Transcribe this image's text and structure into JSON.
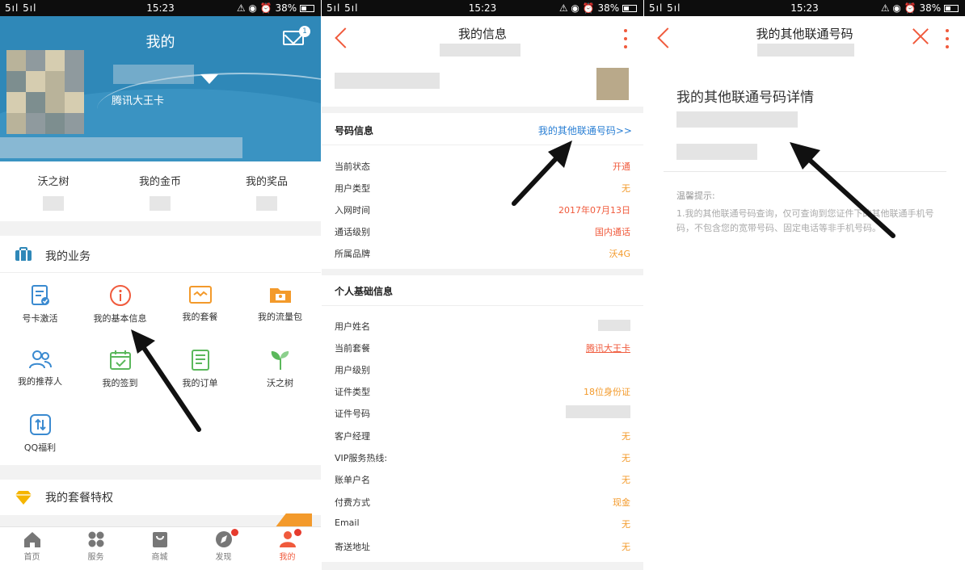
{
  "status_bar": {
    "signal": "5ıl 5ıl",
    "time": "15:23",
    "right_icons": "⚠ ◉ ⏰",
    "battery": "38%"
  },
  "panel1": {
    "title": "我的",
    "mail_badge": "1",
    "user_plan": "腾讯大王卡",
    "stats": [
      "沃之树",
      "我的金币",
      "我的奖品"
    ],
    "business_title": "我的业务",
    "services": [
      {
        "label": "号卡激活",
        "icon": "sim-activate-icon"
      },
      {
        "label": "我的基本信息",
        "icon": "info-icon"
      },
      {
        "label": "我的套餐",
        "icon": "package-icon"
      },
      {
        "label": "我的流量包",
        "icon": "data-pack-icon"
      },
      {
        "label": "我的推荐人",
        "icon": "referrer-icon"
      },
      {
        "label": "我的签到",
        "icon": "checkin-icon"
      },
      {
        "label": "我的订单",
        "icon": "order-icon"
      },
      {
        "label": "沃之树",
        "icon": "tree-icon"
      },
      {
        "label": "QQ福利",
        "icon": "qq-benefit-icon"
      }
    ],
    "privilege_title": "我的套餐特权",
    "tabs": [
      {
        "label": "首页",
        "icon": "home-icon"
      },
      {
        "label": "服务",
        "icon": "service-icon"
      },
      {
        "label": "商城",
        "icon": "shop-icon"
      },
      {
        "label": "发现",
        "icon": "discover-icon"
      },
      {
        "label": "我的",
        "icon": "profile-icon"
      }
    ],
    "colors": {
      "header": "#2f88b8",
      "accent": "#f05a3c"
    }
  },
  "panel2": {
    "title": "我的信息",
    "number_section": "号码信息",
    "other_numbers_link": "我的其他联通号码>>",
    "number_rows": [
      {
        "key": "当前状态",
        "value": "开通"
      },
      {
        "key": "用户类型",
        "value": "无"
      },
      {
        "key": "入网时间",
        "value": "2017年07月13日"
      },
      {
        "key": "通话级别",
        "value": "国内通话"
      },
      {
        "key": "所属品牌",
        "value": "沃4G"
      }
    ],
    "personal_section": "个人基础信息",
    "personal_rows": [
      {
        "key": "用户姓名",
        "value": ""
      },
      {
        "key": "当前套餐",
        "value": "腾讯大王卡"
      },
      {
        "key": "用户级别",
        "value": ""
      },
      {
        "key": "证件类型",
        "value": "18位身份证"
      },
      {
        "key": "证件号码",
        "value": ""
      },
      {
        "key": "客户经理",
        "value": "无"
      },
      {
        "key": "VIP服务热线:",
        "value": "无"
      },
      {
        "key": "账单户名",
        "value": "无"
      },
      {
        "key": "付费方式",
        "value": "现金"
      },
      {
        "key": "Email",
        "value": "无"
      },
      {
        "key": "寄送地址",
        "value": "无"
      }
    ]
  },
  "panel3": {
    "title": "我的其他联通号码",
    "heading": "我的其他联通号码详情",
    "tip_title": "温馨提示:",
    "tip_text": "1.我的其他联通号码查询，仅可查询到您证件下的其他联通手机号码，不包含您的宽带号码、固定电话等非手机号码。"
  }
}
